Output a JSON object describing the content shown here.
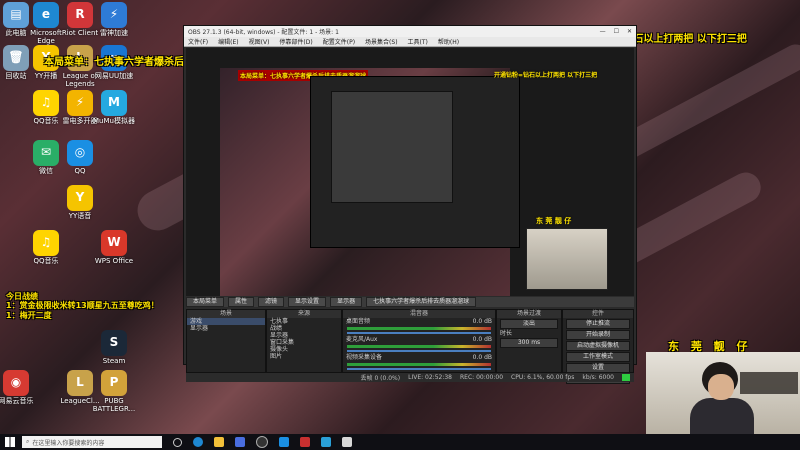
{
  "overlay": {
    "menu_title": "本局菜单：七执事六学者爆杀后排去质器溜溜球",
    "top_right": "开通钻粉=钻石以上打两把 以下打三把",
    "achievement_title": "今日战绩",
    "achievement_line1": "1：赏金极限收米转13顺星九五至尊吃鸡！",
    "achievement_line2": "1：梅开二度",
    "streamer_name": "东 莞 靓 仔"
  },
  "desktop_icons": [
    {
      "label": "此电脑",
      "color": "#5fa0d8",
      "glyph": "▤"
    },
    {
      "label": "Microsoft\nEdge",
      "color": "#1e88d2",
      "glyph": "e"
    },
    {
      "label": "Riot Client",
      "color": "#d13639",
      "glyph": "R"
    },
    {
      "label": "雷神加速",
      "color": "#2e7bd6",
      "glyph": "⚡"
    },
    {
      "label": "回收站",
      "color": "#7f9fb8",
      "glyph": "🗑"
    },
    {
      "label": "YY开播",
      "color": "#f5c400",
      "glyph": "Y"
    },
    {
      "label": "League of\nLegends",
      "color": "#c8a24a",
      "glyph": "L"
    },
    {
      "label": "网易UU加速",
      "color": "#1976d2",
      "glyph": "∞"
    },
    {
      "label": "QQ音乐",
      "color": "#ffd400",
      "glyph": "♫"
    },
    {
      "label": "雷电多开器",
      "color": "#f3b400",
      "glyph": "⚡"
    },
    {
      "label": "MuMu模拟器",
      "color": "#25a9e0",
      "glyph": "M"
    },
    {
      "label": "微信",
      "color": "#2aae67",
      "glyph": "✉"
    },
    {
      "label": "QQ",
      "color": "#1a8fe3",
      "glyph": "◎"
    },
    {
      "label": "YY语音",
      "color": "#f5c400",
      "glyph": "Y"
    },
    {
      "label": "WPS Office",
      "color": "#d9382a",
      "glyph": "W"
    },
    {
      "label": "QQ音乐",
      "color": "#ffd400",
      "glyph": "♫"
    },
    {
      "label": "网易云音乐",
      "color": "#d63a32",
      "glyph": "◉"
    },
    {
      "label": "LeagueCl...",
      "color": "#c8a24a",
      "glyph": "L"
    },
    {
      "label": "Steam",
      "color": "#1b2838",
      "glyph": "S"
    },
    {
      "label": "PUBG\nBATTLEGR...",
      "color": "#d2a23a",
      "glyph": "P"
    }
  ],
  "obs": {
    "window_title": "OBS 27.1.3 (64-bit, windows) - 配置文件: 1 - 场景: 1",
    "menu": [
      "文件(F)",
      "编辑(E)",
      "视图(V)",
      "停靠部件(D)",
      "配置文件(P)",
      "场景集合(S)",
      "工具(T)",
      "帮助(H)"
    ],
    "dock_tabs": [
      "本局菜单",
      "属性",
      "滤镜",
      "显示设置",
      "显示器",
      "七执事六学者爆杀后排去质器溜溜球"
    ],
    "scenes_header": "场景",
    "scenes": [
      "游戏",
      "显示器"
    ],
    "sources_header": "来源",
    "sources": [
      "七执事",
      "战绩",
      "显示器",
      "窗口采集",
      "摄像头",
      "图片"
    ],
    "mixer_header": "混音器",
    "mixer": [
      {
        "name": "桌面音频",
        "db": "0.0 dB"
      },
      {
        "name": "麦克风/Aux",
        "db": "0.0 dB"
      },
      {
        "name": "视频采集设备",
        "db": "0.0 dB"
      }
    ],
    "transition_header": "场景过渡",
    "transition_type": "淡出",
    "transition_duration_label": "时长",
    "transition_duration": "300 ms",
    "controls_header": "控件",
    "controls": [
      "停止推流",
      "开始录制",
      "启动虚拟摄像机",
      "工作室模式",
      "设置",
      "退出"
    ],
    "status": {
      "dropped": "丢帧 0 (0.0%)",
      "live": "LIVE: 02:52:38",
      "rec": "REC: 00:00:00",
      "cpu": "CPU: 6.1%, 60.00 fps",
      "bitrate": "kb/s: 6000"
    }
  },
  "taskbar": {
    "search_placeholder": "在这里输入你要搜索的内容"
  }
}
